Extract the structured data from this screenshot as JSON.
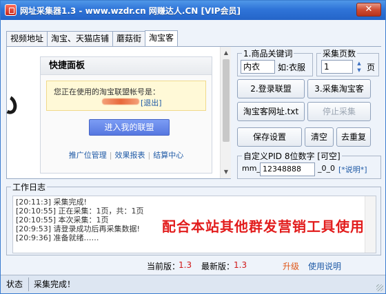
{
  "window": {
    "title": "网址采集器1.3 - www.wzdr.cn 网赚达人.CN [VIP会员]",
    "close_label": "✕"
  },
  "tabs": [
    "视频地址",
    "淘宝、天猫店铺",
    "蘑菇街",
    "淘宝客"
  ],
  "active_tab": "淘宝客",
  "browser": {
    "panel_title": "快捷面板",
    "account_notice": "您正在使用的淘宝联盟帐号是：",
    "logout_label": "[退出]",
    "enter_button": "进入我的联盟",
    "links": [
      "推广位管理",
      "效果报表",
      "结算中心"
    ]
  },
  "keyword": {
    "group_label": "1.商品关键词",
    "value": "内衣",
    "example": "如:衣服"
  },
  "pages": {
    "group_label": "采集页数",
    "value": "1",
    "unit": "页"
  },
  "buttons": {
    "login": "2.登录联盟",
    "collect": "3.采集淘宝客",
    "url_file": "淘宝客网址.txt",
    "stop": "停止采集",
    "save": "保存设置",
    "clear": "清空",
    "dedupe": "去重复"
  },
  "pid": {
    "group_label": "自定义PID 8位数字 [可空]",
    "prefix": "mm_",
    "value": "12348888",
    "suffix": "_0_0",
    "help_link": "[*说明*]"
  },
  "log": {
    "label": "工作日志",
    "lines": [
      "[20:11:3] 采集完成!",
      "[20:10:55] 正在采集：1页，共：1页",
      "[20:10:55] 本次采集：1页",
      "[20:9:53] 请登录成功后再采集数据!",
      "[20:9:36] 准备就绪……"
    ],
    "promo": "配合本站其他群发营销工具使用"
  },
  "version": {
    "current_label": "当前版：",
    "current": "1.3",
    "latest_label": "最新版：",
    "latest": "1.3",
    "upgrade": "升级",
    "help": "使用说明"
  },
  "status": {
    "label": "状态",
    "text": "采集完成！"
  },
  "colors": {
    "title_bar": "#2f74d8",
    "accent_button": "#5677e0",
    "log_promo": "#e21c1c",
    "version_number": "#d01818",
    "link": "#1f5aa6"
  }
}
